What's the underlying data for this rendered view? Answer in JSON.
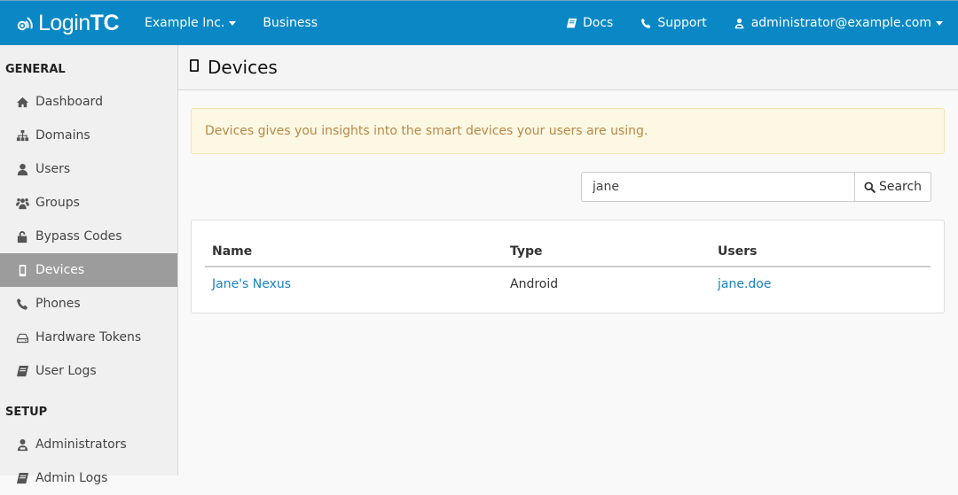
{
  "navbar": {
    "brand": {
      "light": "Login",
      "bold": "TC"
    },
    "org_menu": "Example Inc.",
    "plan_link": "Business",
    "docs": {
      "label": "Docs",
      "icon": "book-icon"
    },
    "support": {
      "label": "Support",
      "icon": "phone-icon"
    },
    "account": {
      "label": "administrator@example.com",
      "icon": "user-md-icon"
    },
    "brand_color": "#0a88c5"
  },
  "sidebar": {
    "sections": [
      {
        "title": "GENERAL",
        "items": [
          {
            "label": "Dashboard",
            "icon": "home-icon",
            "active": false
          },
          {
            "label": "Domains",
            "icon": "sitemap-icon",
            "active": false
          },
          {
            "label": "Users",
            "icon": "user-icon",
            "active": false
          },
          {
            "label": "Groups",
            "icon": "users-icon",
            "active": false
          },
          {
            "label": "Bypass Codes",
            "icon": "unlock-icon",
            "active": false
          },
          {
            "label": "Devices",
            "icon": "mobile-icon",
            "active": true
          },
          {
            "label": "Phones",
            "icon": "phone-icon",
            "active": false
          },
          {
            "label": "Hardware Tokens",
            "icon": "hdd-icon",
            "active": false
          },
          {
            "label": "User Logs",
            "icon": "book-icon",
            "active": false
          }
        ]
      },
      {
        "title": "SETUP",
        "items": [
          {
            "label": "Administrators",
            "icon": "user-md-icon",
            "active": false
          },
          {
            "label": "Admin Logs",
            "icon": "book-icon",
            "active": false
          }
        ]
      }
    ]
  },
  "main": {
    "title": "Devices",
    "title_icon": "mobile-icon",
    "alert": "Devices gives you insights into the smart devices your users are using.",
    "search": {
      "value": "jane",
      "button": "Search"
    },
    "table": {
      "columns": [
        "Name",
        "Type",
        "Users"
      ],
      "rows": [
        {
          "name": "Jane's Nexus",
          "type": "Android",
          "users": "jane.doe"
        }
      ]
    }
  }
}
